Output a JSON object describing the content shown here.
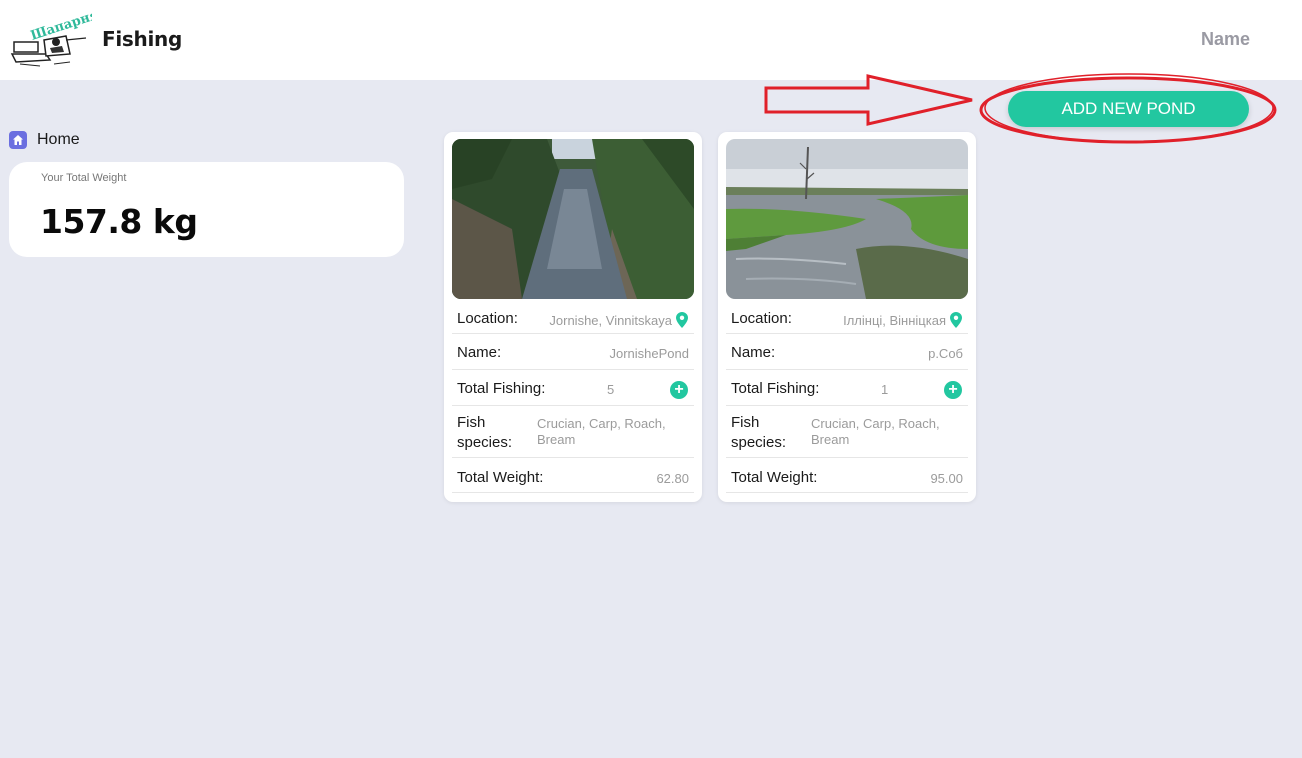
{
  "app": {
    "title": "Fishing",
    "user_name": "Name",
    "logo_text": "Шапарня"
  },
  "sidebar": {
    "home_label": "Home"
  },
  "summary": {
    "caption": "Your Total Weight",
    "value": "157.8 kg"
  },
  "actions": {
    "add_pond_label": "ADD NEW POND"
  },
  "labels": {
    "location": "Location:",
    "name": "Name:",
    "total_fishing": "Total Fishing:",
    "fish_species_line1": "Fish",
    "fish_species_line2": "species:",
    "total_weight": "Total Weight:"
  },
  "ponds": [
    {
      "location": "Jornishe, Vinnitskaya",
      "name": "JornishePond",
      "total_fishing": "5",
      "fish_species_line1": "Crucian, Carp, Roach,",
      "fish_species_line2": "Bream",
      "total_weight": "62.80",
      "image": "river-canyon"
    },
    {
      "location": "Іллінці, Вінніцкая",
      "name": "р.Соб",
      "total_fishing": "1",
      "fish_species_line1": "Crucian, Carp, Roach,",
      "fish_species_line2": "Bream",
      "total_weight": "95.00",
      "image": "river-meadow"
    }
  ],
  "icons": {
    "home": "home-icon",
    "location": "map-pin-icon",
    "add": "plus-icon"
  },
  "colors": {
    "accent": "#22c7a0",
    "background": "#e7e9f2",
    "annotation": "#e0202a",
    "home_icon": "#6b6fe0"
  }
}
